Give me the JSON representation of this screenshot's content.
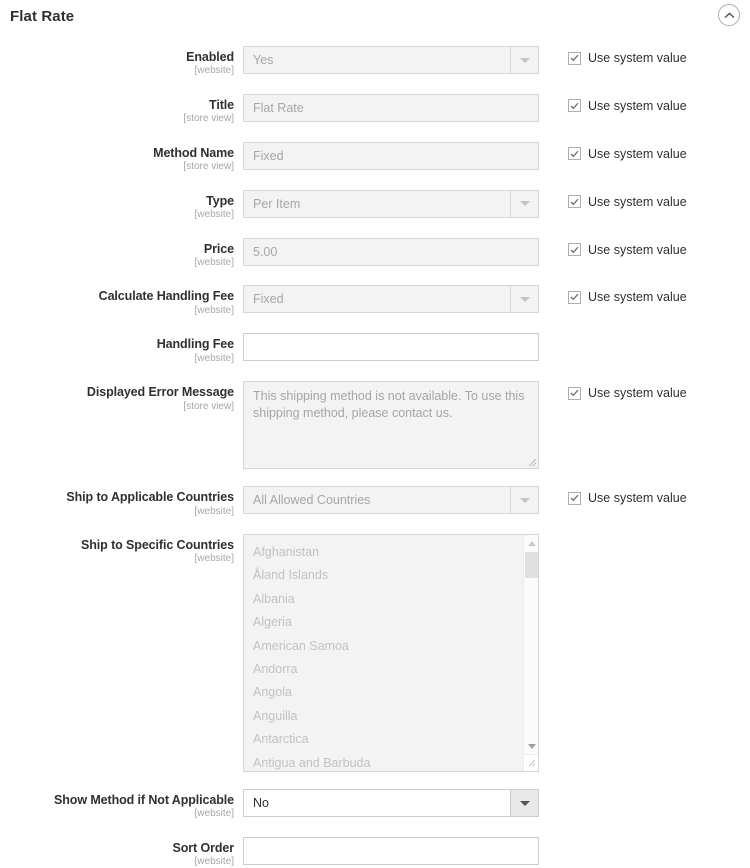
{
  "section": {
    "title": "Flat Rate",
    "collapse_icon": "chevron-up-circle-icon"
  },
  "common": {
    "use_system_value_label": "Use system value",
    "check_icon": "check-icon",
    "dropdown_icon": "chevron-down-icon",
    "scroll_up_icon": "triangle-up-icon",
    "scroll_down_icon": "triangle-down-icon",
    "resize_icon": "resize-grip-icon"
  },
  "scopes": {
    "website": "[website]",
    "store_view": "[store view]"
  },
  "fields": {
    "enabled": {
      "label": "Enabled",
      "scope": "[website]",
      "value": "Yes",
      "type": "select",
      "disabled": true,
      "use_system_value": true
    },
    "title": {
      "label": "Title",
      "scope": "[store view]",
      "value": "Flat Rate",
      "type": "text",
      "disabled": true,
      "use_system_value": true
    },
    "method_name": {
      "label": "Method Name",
      "scope": "[store view]",
      "value": "Fixed",
      "type": "text",
      "disabled": true,
      "use_system_value": true
    },
    "type": {
      "label": "Type",
      "scope": "[website]",
      "value": "Per Item",
      "type": "select",
      "disabled": true,
      "use_system_value": true
    },
    "price": {
      "label": "Price",
      "scope": "[website]",
      "value": "5.00",
      "type": "text",
      "disabled": true,
      "use_system_value": true
    },
    "calculate_handling_fee": {
      "label": "Calculate Handling Fee",
      "scope": "[website]",
      "value": "Fixed",
      "type": "select",
      "disabled": true,
      "use_system_value": true
    },
    "handling_fee": {
      "label": "Handling Fee",
      "scope": "[website]",
      "value": "",
      "type": "text",
      "disabled": false,
      "use_system_value": false
    },
    "displayed_error_message": {
      "label": "Displayed Error Message",
      "scope": "[store view]",
      "value": "This shipping method is not available. To use this shipping method, please contact us.",
      "type": "textarea",
      "disabled": true,
      "use_system_value": true
    },
    "ship_to_applicable_countries": {
      "label": "Ship to Applicable Countries",
      "scope": "[website]",
      "value": "All Allowed Countries",
      "type": "select",
      "disabled": true,
      "use_system_value": true
    },
    "ship_to_specific_countries": {
      "label": "Ship to Specific Countries",
      "scope": "[website]",
      "type": "multiselect",
      "disabled": true,
      "use_system_value": false,
      "options": [
        "Afghanistan",
        "Åland Islands",
        "Albania",
        "Algeria",
        "American Samoa",
        "Andorra",
        "Angola",
        "Anguilla",
        "Antarctica",
        "Antigua and Barbuda"
      ]
    },
    "show_method_if_not_applicable": {
      "label": "Show Method if Not Applicable",
      "scope": "[website]",
      "value": "No",
      "type": "select",
      "disabled": false,
      "use_system_value": false
    },
    "sort_order": {
      "label": "Sort Order",
      "scope": "[website]",
      "value": "",
      "type": "text",
      "disabled": false,
      "use_system_value": false
    }
  }
}
